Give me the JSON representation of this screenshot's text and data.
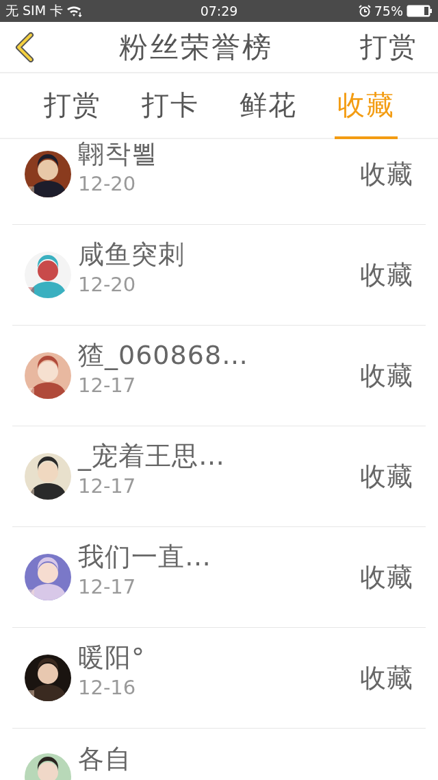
{
  "status_bar": {
    "carrier": "无 SIM 卡",
    "time": "07:29",
    "battery": "75%"
  },
  "header": {
    "title": "粉丝荣誉榜",
    "action": "打赏"
  },
  "tabs": [
    {
      "label": "打赏",
      "selected": false
    },
    {
      "label": "打卡",
      "selected": false
    },
    {
      "label": "鲜花",
      "selected": false
    },
    {
      "label": "收藏",
      "selected": true
    }
  ],
  "fans": [
    {
      "name": "翺착뾜",
      "date": "12-20",
      "action": "收藏"
    },
    {
      "name": "咸鱼突刺",
      "date": "12-20",
      "action": "收藏"
    },
    {
      "name": "猹_060868…",
      "date": "12-17",
      "action": "收藏"
    },
    {
      "name": "_宠着王思…",
      "date": "12-17",
      "action": "收藏"
    },
    {
      "name": "我们一直…",
      "date": "12-17",
      "action": "收藏"
    },
    {
      "name": "暖阳°",
      "date": "12-16",
      "action": "收藏"
    },
    {
      "name": "各自"
    }
  ]
}
